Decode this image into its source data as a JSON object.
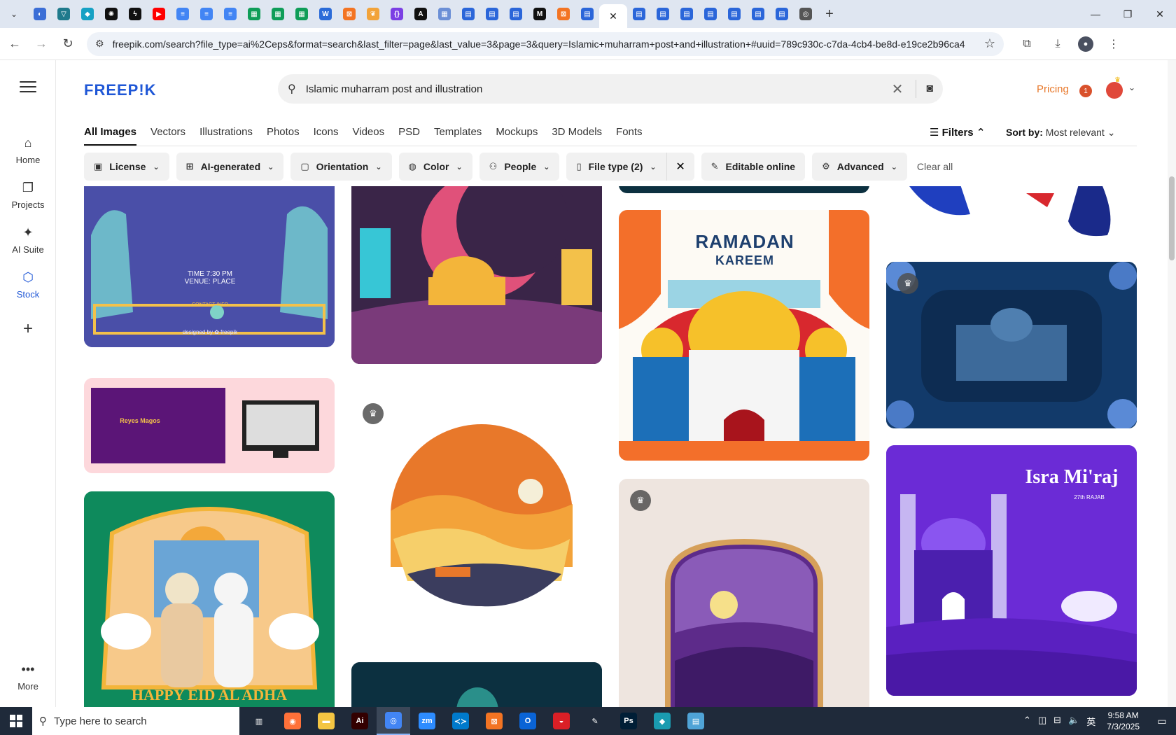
{
  "browser": {
    "tabs": [
      {
        "icon": "globe-icon",
        "color": "#3b6ed6",
        "glyph": "◐"
      },
      {
        "icon": "vpn-icon",
        "color": "#1f7a8c",
        "glyph": "▽"
      },
      {
        "icon": "diamond-icon",
        "color": "#16a1c4",
        "glyph": "◆"
      },
      {
        "icon": "openai-icon",
        "color": "#111111",
        "glyph": "✺"
      },
      {
        "icon": "bolt-icon",
        "color": "#111111",
        "glyph": "ϟ"
      },
      {
        "icon": "youtube-icon",
        "color": "#ff0000",
        "glyph": "▶"
      },
      {
        "icon": "docs-icon",
        "color": "#4285f4",
        "glyph": "≡"
      },
      {
        "icon": "docs-icon",
        "color": "#4285f4",
        "glyph": "≡"
      },
      {
        "icon": "docs-icon",
        "color": "#4285f4",
        "glyph": "≡"
      },
      {
        "icon": "sheets-icon",
        "color": "#0f9d58",
        "glyph": "▦"
      },
      {
        "icon": "sheets-icon",
        "color": "#0f9d58",
        "glyph": "▦"
      },
      {
        "icon": "sheets-icon",
        "color": "#0f9d58",
        "glyph": "▦"
      },
      {
        "icon": "word-icon",
        "color": "#2b6bd8",
        "glyph": "W"
      },
      {
        "icon": "xampp-icon",
        "color": "#f37423",
        "glyph": "⊠"
      },
      {
        "icon": "bird-icon",
        "color": "#f2a33a",
        "glyph": "❦"
      },
      {
        "icon": "code-icon",
        "color": "#7b3fe4",
        "glyph": "{}"
      },
      {
        "icon": "anthropic-icon",
        "color": "#111111",
        "glyph": "A"
      },
      {
        "icon": "grid-icon",
        "color": "#6b8fd6",
        "glyph": "▦"
      },
      {
        "icon": "forms-icon",
        "color": "#2b66d9",
        "glyph": "▤"
      },
      {
        "icon": "forms-icon",
        "color": "#2b66d9",
        "glyph": "▤"
      },
      {
        "icon": "forms-icon",
        "color": "#2b66d9",
        "glyph": "▤"
      },
      {
        "icon": "medium-icon",
        "color": "#111111",
        "glyph": "M"
      },
      {
        "icon": "xampp-icon",
        "color": "#f37423",
        "glyph": "⊠"
      },
      {
        "icon": "forms-icon",
        "color": "#2b66d9",
        "glyph": "▤"
      }
    ],
    "tabs_after": [
      {
        "icon": "forms-icon",
        "color": "#2b66d9",
        "glyph": "▤"
      },
      {
        "icon": "forms-icon",
        "color": "#2b66d9",
        "glyph": "▤"
      },
      {
        "icon": "forms-icon",
        "color": "#2b66d9",
        "glyph": "▤"
      },
      {
        "icon": "forms-icon",
        "color": "#2b66d9",
        "glyph": "▤"
      },
      {
        "icon": "forms-icon",
        "color": "#2b66d9",
        "glyph": "▤"
      },
      {
        "icon": "forms-icon",
        "color": "#2b66d9",
        "glyph": "▤"
      },
      {
        "icon": "forms-icon",
        "color": "#2b66d9",
        "glyph": "▤"
      },
      {
        "icon": "chrome-icon",
        "color": "#555555",
        "glyph": "◎"
      }
    ],
    "active_tab_close": "✕",
    "new_tab": "+",
    "url": "freepik.com/search?file_type=ai%2Ceps&format=search&last_filter=page&last_value=3&page=3&query=Islamic+muharram+post+and+illustration+#uuid=789c930c-c7da-4cb4-be8d-e19ce2b96ca4"
  },
  "site": {
    "logo": "FREEP!K",
    "search_value": "Islamic muharram post and illustration",
    "pricing": "Pricing",
    "notif_count": "1",
    "rail": [
      {
        "label": "Home",
        "glyph": "⌂"
      },
      {
        "label": "Projects",
        "glyph": "❐"
      },
      {
        "label": "AI Suite",
        "glyph": "✦"
      },
      {
        "label": "Stock",
        "glyph": "⬡"
      }
    ],
    "rail_more": "More",
    "categories": [
      "All Images",
      "Vectors",
      "Illustrations",
      "Photos",
      "Icons",
      "Videos",
      "PSD",
      "Templates",
      "Mockups",
      "3D Models",
      "Fonts"
    ],
    "filters_label": "Filters",
    "sort_label": "Sort by:",
    "sort_value": "Most relevant",
    "chips": [
      {
        "label": "License",
        "icon": "▣"
      },
      {
        "label": "AI-generated",
        "icon": "⊞"
      },
      {
        "label": "Orientation",
        "icon": "▢"
      },
      {
        "label": "Color",
        "icon": "◍"
      },
      {
        "label": "People",
        "icon": "⚇"
      },
      {
        "label": "File type (2)",
        "icon": "▯"
      }
    ],
    "editable_online": "Editable online",
    "advanced": "Advanced",
    "clear_all": "Clear all"
  },
  "cards": {
    "c1_lines": "TIME 7:30 PM\nVENUE: PLACE",
    "c1_contact": "CONTACT INFO",
    "c1_designed": "designed by ✿ freepik",
    "c2_title": "Reyes Magos",
    "c3_title": "HAPPY EID AL ADHA",
    "c5_title1": "RAMADAN",
    "c5_title2": "KAREEM",
    "c8_title": "Isra Mi'raj",
    "c8_sub": "27th RAJAB"
  },
  "taskbar": {
    "search_placeholder": "Type here to search",
    "time": "9:58 AM",
    "date": "7/3/2025",
    "apps": [
      {
        "icon": "task-view-icon",
        "color": "#1f2a3a",
        "glyph": "▥"
      },
      {
        "icon": "firefox-icon",
        "color": "#ff7139",
        "glyph": "◉"
      },
      {
        "icon": "explorer-icon",
        "color": "#f4c542",
        "glyph": "▬"
      },
      {
        "icon": "illustrator-icon",
        "color": "#330000",
        "glyph": "Ai"
      },
      {
        "icon": "chrome-icon",
        "color": "#4285f4",
        "glyph": "◎"
      },
      {
        "icon": "zoom-icon",
        "color": "#2d8cff",
        "glyph": "zm"
      },
      {
        "icon": "vscode-icon",
        "color": "#007acc",
        "glyph": "≺≻"
      },
      {
        "icon": "xampp-icon",
        "color": "#f37423",
        "glyph": "⊠"
      },
      {
        "icon": "outlook-icon",
        "color": "#0a64d6",
        "glyph": "O"
      },
      {
        "icon": "creative-cloud-icon",
        "color": "#da1f26",
        "glyph": "◒"
      },
      {
        "icon": "pen-icon",
        "color": "#1f2a3a",
        "glyph": "✎"
      },
      {
        "icon": "photoshop-icon",
        "color": "#001e36",
        "glyph": "Ps"
      },
      {
        "icon": "gem-icon",
        "color": "#1a9bb0",
        "glyph": "◆"
      },
      {
        "icon": "notepad-icon",
        "color": "#4fa3d6",
        "glyph": "▤"
      }
    ]
  }
}
